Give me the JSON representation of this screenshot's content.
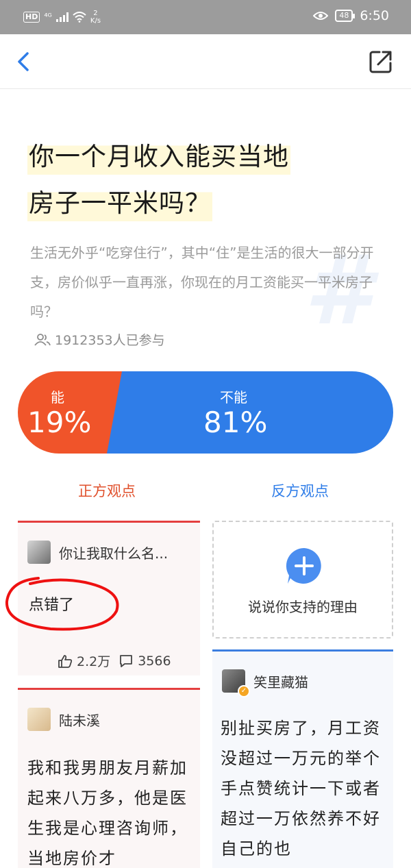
{
  "status_bar": {
    "network_badge": "HD",
    "signal_text": "⁴ᴳ",
    "speed_value": "2",
    "speed_unit": "K/s",
    "battery": "48",
    "time": "6:50"
  },
  "nav": {
    "back_icon": "chevron-left-icon",
    "share_icon": "share-icon"
  },
  "question": {
    "title_line1": "你一个月收入能买当地",
    "title_line2": "房子一平米吗？",
    "description": "生活无外乎“吃穿住行”，其中“住”是生活的很大一部分开支，房价似乎一直再涨，你现在的月工资能买一平米房子吗？",
    "participants": "1912353人已参与"
  },
  "vote": {
    "yes_label": "能",
    "yes_percent": "19%",
    "yes_fraction": 0.19,
    "no_label": "不能",
    "no_percent": "81%",
    "no_fraction": 0.81,
    "yes_color": "#f0542a",
    "no_color": "#2f7de8"
  },
  "sides": {
    "positive": "正方观点",
    "negative": "反方观点"
  },
  "cards": {
    "card1": {
      "author": "你让我取什么名...",
      "content": "点错了",
      "likes": "2.2万",
      "comments": "3566"
    },
    "card2": {
      "author": "陆未溪",
      "content": "我和我男朋友月薪加起来八万多，他是医生我是心理咨询师，当地房价才"
    },
    "card3": {
      "author": "笑里藏猫",
      "content": "别扯买房了，月工资没超过一万元的举个手点赞统计一下或者超过一万依然养不好自己的也"
    }
  },
  "add_reason": {
    "label": "说说你支持的理由",
    "icon": "plus-bubble-icon"
  }
}
